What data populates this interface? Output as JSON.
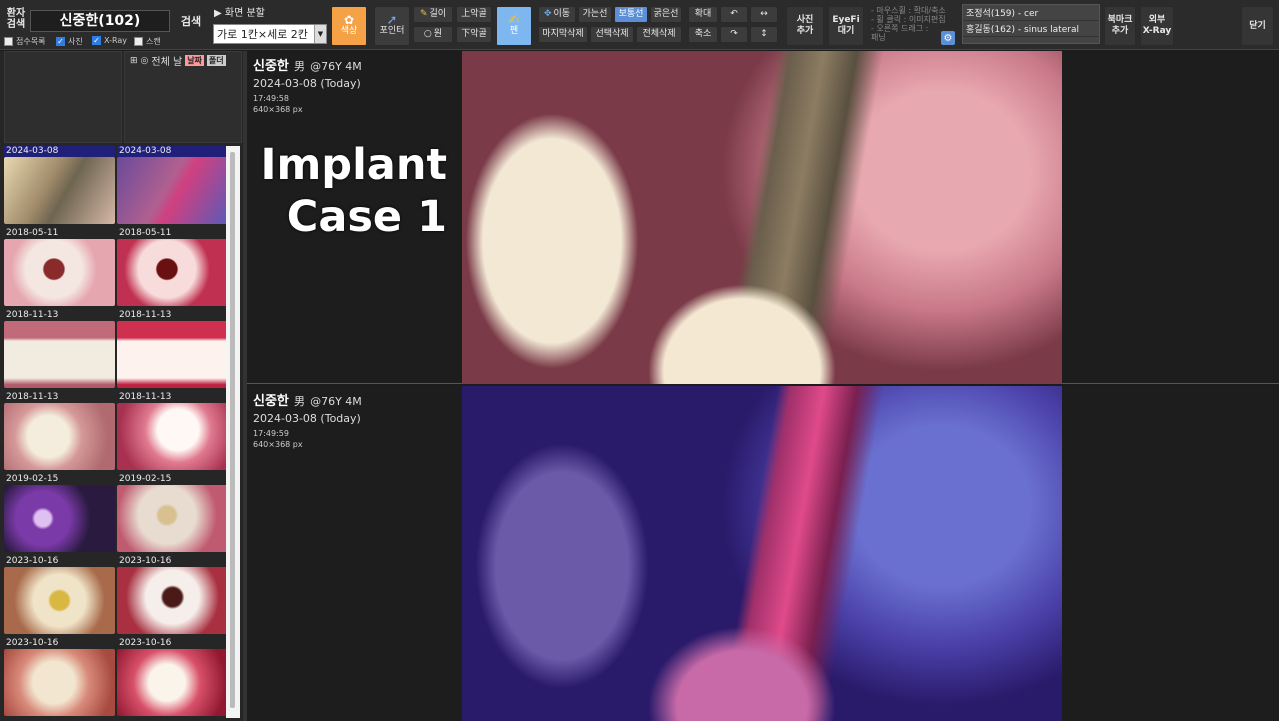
{
  "toolbar": {
    "patient_search_label_1": "환자",
    "patient_search_label_2": "검색",
    "patient_name": "신중한(102)",
    "search_button": "검색",
    "checkboxes": [
      {
        "label": "접수목록",
        "checked": false
      },
      {
        "label": "사진",
        "checked": true
      },
      {
        "label": "X-Ray",
        "checked": true
      },
      {
        "label": "스캔",
        "checked": false
      }
    ],
    "screen_split_label": "▶ 화면 분할",
    "screen_split_value": "가로 1칸×세로 2칸",
    "color_button": "색상",
    "pointer_button": "포인터",
    "length_button": "길이",
    "circle_button": "원",
    "upper_jaw_button": "上악골",
    "lower_jaw_button": "下악골",
    "pen_button": "펜",
    "move_button": "이동",
    "thin_line_button": "가는선",
    "normal_line_button": "보통선",
    "thick_line_button": "굵은선",
    "delete_last_button": "마지막삭제",
    "delete_selected_button": "선택삭제",
    "delete_all_button": "전체삭제",
    "zoom_in_button": "확대",
    "zoom_out_button": "축소",
    "add_photo_button_1": "사진",
    "add_photo_button_2": "추가",
    "eyefi_button_1": "EyeFi",
    "eyefi_button_2": "대기",
    "hint_lines": [
      "- 마우스휠 : 확대/축소",
      "- 휠 클릭 : 이미지편집",
      "- 오른쪽 드래그 :",
      "  패닝"
    ],
    "recent_patients": [
      "조정석(159) - cer",
      "홍길동(162) - sinus lateral"
    ],
    "bookmark_button_1": "북마크",
    "bookmark_button_2": "추가",
    "external_xray_button_1": "외부",
    "external_xray_button_2": "X-Ray",
    "close_button": "닫기"
  },
  "sidebar": {
    "header_label": "전체 날",
    "date_tab": "날짜",
    "folder_tab": "폴더",
    "thumbnails": [
      {
        "date": "2024-03-08",
        "selected": true,
        "bg": "linear-gradient(120deg,#e8d9b0,#a08a6a 40%,#6e6550 55%,#d6b8a8)"
      },
      {
        "date": "2024-03-08",
        "selected": true,
        "bg": "linear-gradient(120deg,#6a4a9a,#b06090 45%,#d04080 55%,#5a5ab8)"
      },
      {
        "date": "2018-05-11",
        "selected": false,
        "bg": "radial-gradient(circle at 45% 45%,#8a2a2a 0 14%,#f4e6e0 16% 40%,#e6a6b0 60%)"
      },
      {
        "date": "2018-05-11",
        "selected": false,
        "bg": "radial-gradient(circle at 45% 45%,#6a1010 0 14%,#f8dcdc 16% 40%,#c03050 60%)"
      },
      {
        "date": "2018-11-13",
        "selected": false,
        "bg": "linear-gradient(180deg,#c06a7a 0 25%,#f2ece0 30% 85%,#b05a6a 95%)"
      },
      {
        "date": "2018-11-13",
        "selected": false,
        "bg": "linear-gradient(180deg,#d03050 0 25%,#fdf2ee 30% 85%,#c02040 95%)"
      },
      {
        "date": "2018-11-13",
        "selected": false,
        "bg": "radial-gradient(circle at 40% 50%,#f4ecdc 0 28%,#d59898 45%,#b06a70 80%)"
      },
      {
        "date": "2018-11-13",
        "selected": false,
        "bg": "radial-gradient(circle at 55% 40%,#fff8f4 0 28%,#e07a90 45%,#a83050 80%)"
      },
      {
        "date": "2019-02-15",
        "selected": false,
        "bg": "radial-gradient(circle at 35% 50%,#e0c0f0 0 10%,#7a3aa8 14% 34%,#2a1a40 60%)"
      },
      {
        "date": "2019-02-15",
        "selected": false,
        "bg": "radial-gradient(circle at 45% 45%,#d8c090 0 12%,#e8dcd0 16% 40%,#c05a70 70%)"
      },
      {
        "date": "2023-10-16",
        "selected": false,
        "bg": "radial-gradient(circle at 50% 50%,#d8b840 0 14%,#f0e4c8 18% 40%,#a86a4a 70%)"
      },
      {
        "date": "2023-10-16",
        "selected": false,
        "bg": "radial-gradient(circle at 50% 45%,#4a1a18 0 14%,#f6eeea 18% 40%,#a83040 70%)"
      },
      {
        "date": "2023-10-16",
        "selected": false,
        "bg": "radial-gradient(circle at 45% 50%,#f2e6d0 0 30%,#d88a7a 50%,#a84a40 85%)"
      },
      {
        "date": "2023-10-16",
        "selected": false,
        "bg": "radial-gradient(circle at 45% 50%,#fbf4ea 0 26%,#d8506a 48%,#901830 85%)"
      }
    ]
  },
  "viewer": {
    "overlay_title_1": "Implant",
    "overlay_title_2": "Case 1",
    "panels": [
      {
        "name": "신중한",
        "sex": "男",
        "age": "@76Y 4M",
        "date": "2024-03-08 (Today)",
        "time": "17:49:58",
        "size": "640×368 px"
      },
      {
        "name": "신중한",
        "sex": "男",
        "age": "@76Y 4M",
        "date": "2024-03-08 (Today)",
        "time": "17:49:59",
        "size": "640×368 px"
      }
    ]
  },
  "colors": {
    "accent_orange": "#f5a146",
    "accent_blue": "#7eb6f0",
    "selected_blue": "#5b8fd8",
    "selected_thumb": "#20207a"
  }
}
